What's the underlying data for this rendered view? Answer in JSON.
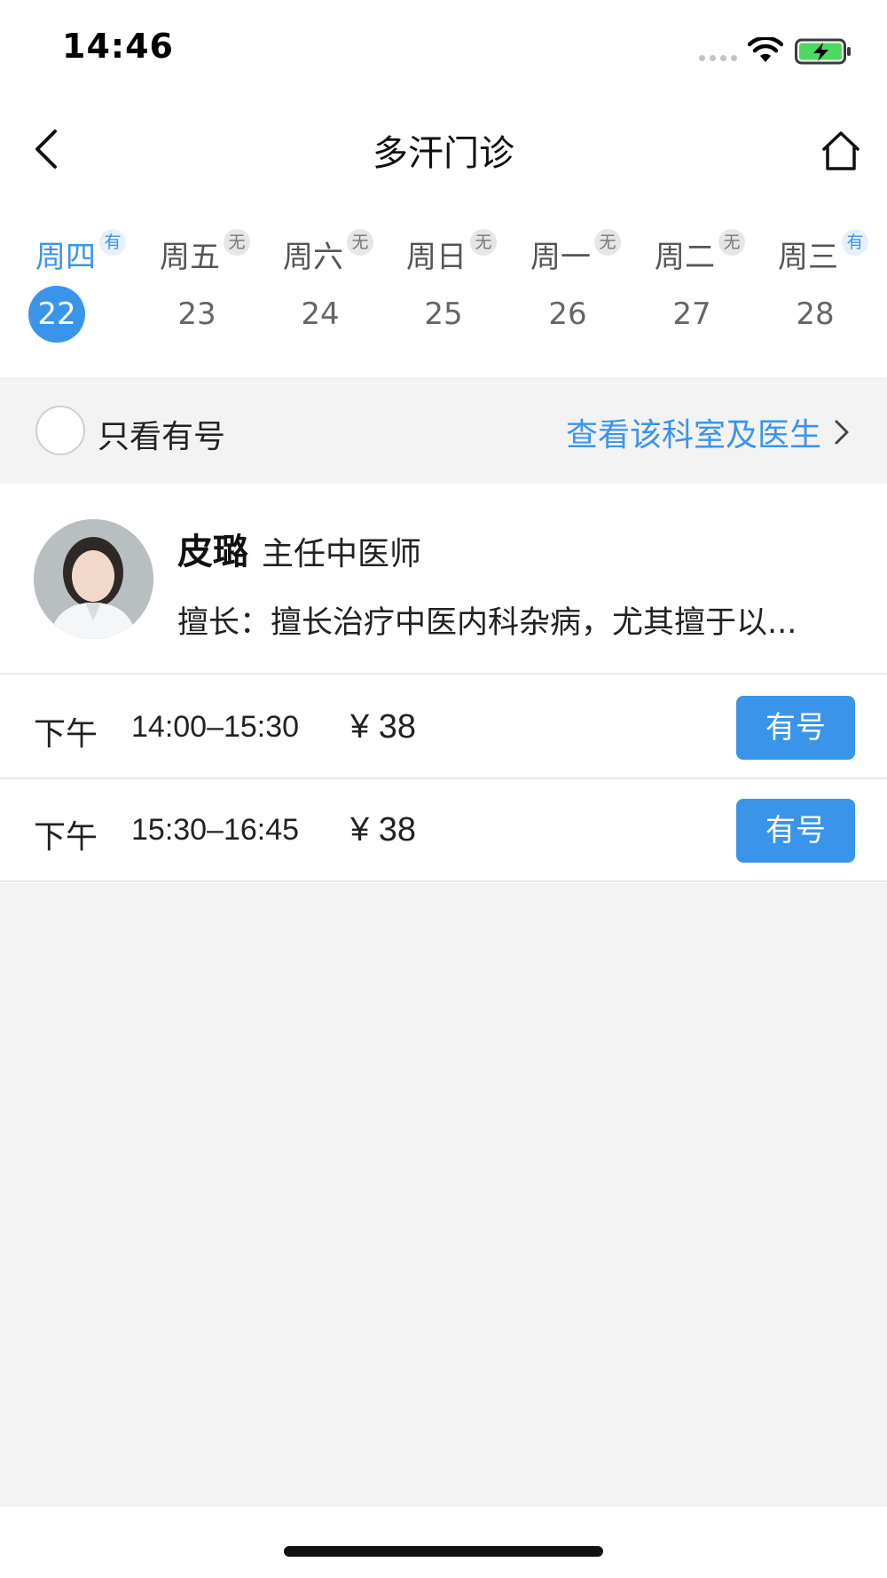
{
  "status_bar": {
    "time": "14:46",
    "battery_state": "charging"
  },
  "nav": {
    "title": "多汗门诊",
    "back_icon": "chevron-left-icon",
    "home_icon": "home-icon"
  },
  "week": {
    "days": [
      {
        "name": "周四",
        "badge": "有",
        "date": "22",
        "selected": true
      },
      {
        "name": "周五",
        "badge": "无",
        "date": "23",
        "selected": false
      },
      {
        "name": "周六",
        "badge": "无",
        "date": "24",
        "selected": false
      },
      {
        "name": "周日",
        "badge": "无",
        "date": "25",
        "selected": false
      },
      {
        "name": "周一",
        "badge": "无",
        "date": "26",
        "selected": false
      },
      {
        "name": "周二",
        "badge": "无",
        "date": "27",
        "selected": false
      },
      {
        "name": "周三",
        "badge": "有",
        "date": "28",
        "selected": false
      }
    ]
  },
  "filter": {
    "only_available_label": "只看有号",
    "checked": false,
    "dept_link_label": "查看该科室及医生"
  },
  "doctor": {
    "name": "皮璐",
    "title": "主任中医师",
    "skill": "擅长：擅长治疗中医内科杂病，尤其擅于以..."
  },
  "slots": [
    {
      "period": "下午",
      "time": "14:00–15:30",
      "price": "¥ 38",
      "button": "有号"
    },
    {
      "period": "下午",
      "time": "15:30–16:45",
      "price": "¥ 38",
      "button": "有号"
    }
  ],
  "colors": {
    "accent": "#3a95ea",
    "background_gray": "#f3f3f3",
    "battery_green": "#4cd964"
  }
}
